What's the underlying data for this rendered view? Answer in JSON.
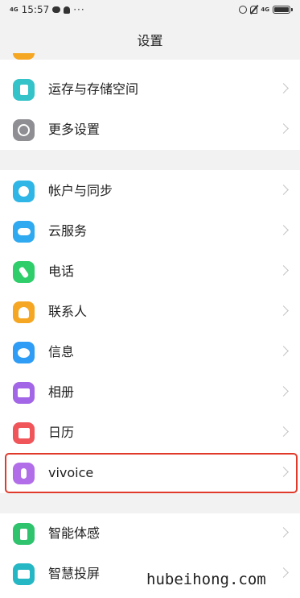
{
  "status_bar": {
    "network_left": "4G",
    "time": "15:57",
    "more": "···",
    "network_right": "4G"
  },
  "header": {
    "title": "设置"
  },
  "settings": [
    {
      "label": "运存与存储空间",
      "icon": "storage-icon",
      "color": "#34c3c8"
    },
    {
      "label": "更多设置",
      "icon": "more-settings-icon",
      "color": "#8e8e93"
    },
    {
      "label": "帐户与同步",
      "icon": "account-sync-icon",
      "color": "#2fb6e6"
    },
    {
      "label": "云服务",
      "icon": "cloud-icon",
      "color": "#2fa9f0"
    },
    {
      "label": "电话",
      "icon": "phone-icon",
      "color": "#2fce6b"
    },
    {
      "label": "联系人",
      "icon": "contacts-icon",
      "color": "#f5a623"
    },
    {
      "label": "信息",
      "icon": "message-icon",
      "color": "#2f9cf5"
    },
    {
      "label": "相册",
      "icon": "album-icon",
      "color": "#a266e6"
    },
    {
      "label": "日历",
      "icon": "calendar-icon",
      "color": "#f0555a"
    },
    {
      "label": "vivoice",
      "icon": "microphone-icon",
      "color": "#b26ee8"
    },
    {
      "label": "智能体感",
      "icon": "smart-motion-icon",
      "color": "#2fc36e"
    },
    {
      "label": "智慧投屏",
      "icon": "screen-cast-icon",
      "color": "#26b7c4"
    }
  ],
  "watermark": "hubeihong.com"
}
